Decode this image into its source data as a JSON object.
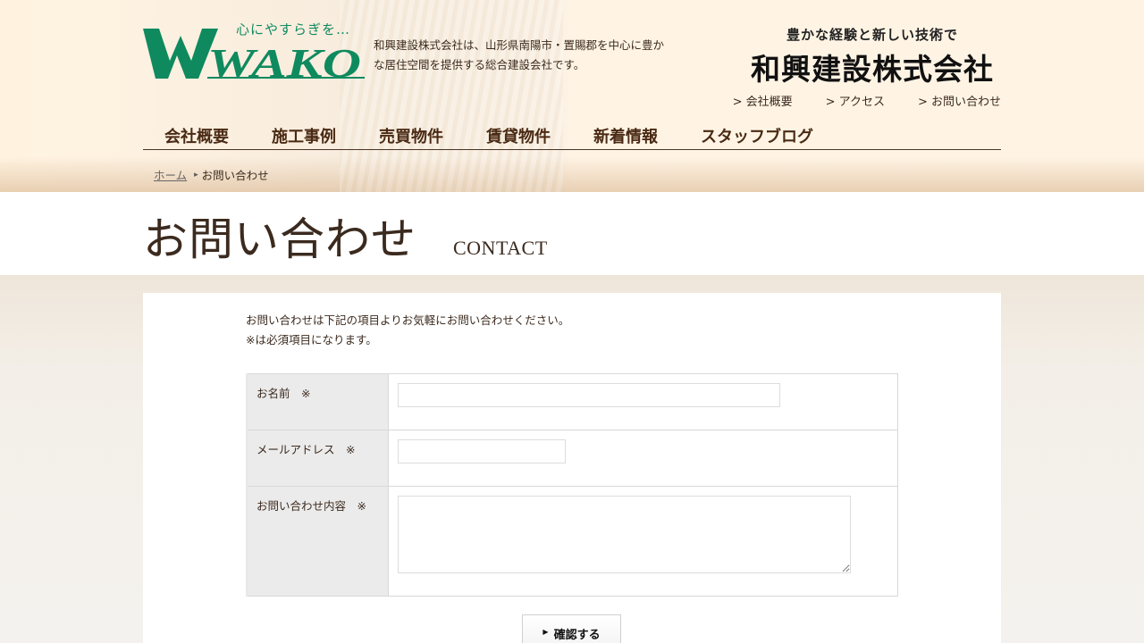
{
  "header": {
    "logo_tagline": "心にやすらぎを…",
    "logo_text": "WAKO",
    "description": "和興建設株式会社は、山形県南陽市・置賜郡を中心に豊かな居住空間を提供する総合建設会社です。",
    "brand_tagline": "豊かな経験と新しい技術で",
    "brand_name": "和興建設株式会社",
    "brand_color": "#0f8a5f",
    "util_links": [
      {
        "label": "> 会社概要"
      },
      {
        "label": "> アクセス"
      },
      {
        "label": "> お問い合わせ"
      }
    ]
  },
  "gnav": {
    "items": [
      {
        "label": "会社概要"
      },
      {
        "label": "施工事例"
      },
      {
        "label": "売買物件"
      },
      {
        "label": "賃貸物件"
      },
      {
        "label": "新着情報"
      },
      {
        "label": "スタッフブログ"
      }
    ]
  },
  "breadcrumb": {
    "home": "ホーム",
    "current": "お問い合わせ"
  },
  "page": {
    "title": "お問い合わせ",
    "subtitle": "CONTACT"
  },
  "form": {
    "intro_line1": "お問い合わせは下記の項目よりお気軽にお問い合わせください。",
    "intro_line2": "※は必須項目になります。",
    "name_label": "お名前　※",
    "name_value": "",
    "email_label": "メールアドレス　※",
    "email_value": "",
    "message_label": "お問い合わせ内容　※",
    "message_value": "",
    "confirm_label": "確認する"
  }
}
